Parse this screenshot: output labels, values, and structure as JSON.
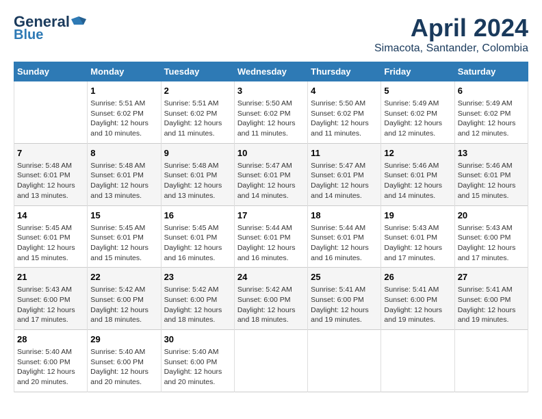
{
  "header": {
    "logo_line1": "General",
    "logo_line2": "Blue",
    "month": "April 2024",
    "location": "Simacota, Santander, Colombia"
  },
  "days_of_week": [
    "Sunday",
    "Monday",
    "Tuesday",
    "Wednesday",
    "Thursday",
    "Friday",
    "Saturday"
  ],
  "weeks": [
    [
      {
        "day": "",
        "info": ""
      },
      {
        "day": "1",
        "info": "Sunrise: 5:51 AM\nSunset: 6:02 PM\nDaylight: 12 hours\nand 10 minutes."
      },
      {
        "day": "2",
        "info": "Sunrise: 5:51 AM\nSunset: 6:02 PM\nDaylight: 12 hours\nand 11 minutes."
      },
      {
        "day": "3",
        "info": "Sunrise: 5:50 AM\nSunset: 6:02 PM\nDaylight: 12 hours\nand 11 minutes."
      },
      {
        "day": "4",
        "info": "Sunrise: 5:50 AM\nSunset: 6:02 PM\nDaylight: 12 hours\nand 11 minutes."
      },
      {
        "day": "5",
        "info": "Sunrise: 5:49 AM\nSunset: 6:02 PM\nDaylight: 12 hours\nand 12 minutes."
      },
      {
        "day": "6",
        "info": "Sunrise: 5:49 AM\nSunset: 6:02 PM\nDaylight: 12 hours\nand 12 minutes."
      }
    ],
    [
      {
        "day": "7",
        "info": "Sunrise: 5:48 AM\nSunset: 6:01 PM\nDaylight: 12 hours\nand 13 minutes."
      },
      {
        "day": "8",
        "info": "Sunrise: 5:48 AM\nSunset: 6:01 PM\nDaylight: 12 hours\nand 13 minutes."
      },
      {
        "day": "9",
        "info": "Sunrise: 5:48 AM\nSunset: 6:01 PM\nDaylight: 12 hours\nand 13 minutes."
      },
      {
        "day": "10",
        "info": "Sunrise: 5:47 AM\nSunset: 6:01 PM\nDaylight: 12 hours\nand 14 minutes."
      },
      {
        "day": "11",
        "info": "Sunrise: 5:47 AM\nSunset: 6:01 PM\nDaylight: 12 hours\nand 14 minutes."
      },
      {
        "day": "12",
        "info": "Sunrise: 5:46 AM\nSunset: 6:01 PM\nDaylight: 12 hours\nand 14 minutes."
      },
      {
        "day": "13",
        "info": "Sunrise: 5:46 AM\nSunset: 6:01 PM\nDaylight: 12 hours\nand 15 minutes."
      }
    ],
    [
      {
        "day": "14",
        "info": "Sunrise: 5:45 AM\nSunset: 6:01 PM\nDaylight: 12 hours\nand 15 minutes."
      },
      {
        "day": "15",
        "info": "Sunrise: 5:45 AM\nSunset: 6:01 PM\nDaylight: 12 hours\nand 15 minutes."
      },
      {
        "day": "16",
        "info": "Sunrise: 5:45 AM\nSunset: 6:01 PM\nDaylight: 12 hours\nand 16 minutes."
      },
      {
        "day": "17",
        "info": "Sunrise: 5:44 AM\nSunset: 6:01 PM\nDaylight: 12 hours\nand 16 minutes."
      },
      {
        "day": "18",
        "info": "Sunrise: 5:44 AM\nSunset: 6:01 PM\nDaylight: 12 hours\nand 16 minutes."
      },
      {
        "day": "19",
        "info": "Sunrise: 5:43 AM\nSunset: 6:01 PM\nDaylight: 12 hours\nand 17 minutes."
      },
      {
        "day": "20",
        "info": "Sunrise: 5:43 AM\nSunset: 6:00 PM\nDaylight: 12 hours\nand 17 minutes."
      }
    ],
    [
      {
        "day": "21",
        "info": "Sunrise: 5:43 AM\nSunset: 6:00 PM\nDaylight: 12 hours\nand 17 minutes."
      },
      {
        "day": "22",
        "info": "Sunrise: 5:42 AM\nSunset: 6:00 PM\nDaylight: 12 hours\nand 18 minutes."
      },
      {
        "day": "23",
        "info": "Sunrise: 5:42 AM\nSunset: 6:00 PM\nDaylight: 12 hours\nand 18 minutes."
      },
      {
        "day": "24",
        "info": "Sunrise: 5:42 AM\nSunset: 6:00 PM\nDaylight: 12 hours\nand 18 minutes."
      },
      {
        "day": "25",
        "info": "Sunrise: 5:41 AM\nSunset: 6:00 PM\nDaylight: 12 hours\nand 19 minutes."
      },
      {
        "day": "26",
        "info": "Sunrise: 5:41 AM\nSunset: 6:00 PM\nDaylight: 12 hours\nand 19 minutes."
      },
      {
        "day": "27",
        "info": "Sunrise: 5:41 AM\nSunset: 6:00 PM\nDaylight: 12 hours\nand 19 minutes."
      }
    ],
    [
      {
        "day": "28",
        "info": "Sunrise: 5:40 AM\nSunset: 6:00 PM\nDaylight: 12 hours\nand 20 minutes."
      },
      {
        "day": "29",
        "info": "Sunrise: 5:40 AM\nSunset: 6:00 PM\nDaylight: 12 hours\nand 20 minutes."
      },
      {
        "day": "30",
        "info": "Sunrise: 5:40 AM\nSunset: 6:00 PM\nDaylight: 12 hours\nand 20 minutes."
      },
      {
        "day": "",
        "info": ""
      },
      {
        "day": "",
        "info": ""
      },
      {
        "day": "",
        "info": ""
      },
      {
        "day": "",
        "info": ""
      }
    ]
  ]
}
